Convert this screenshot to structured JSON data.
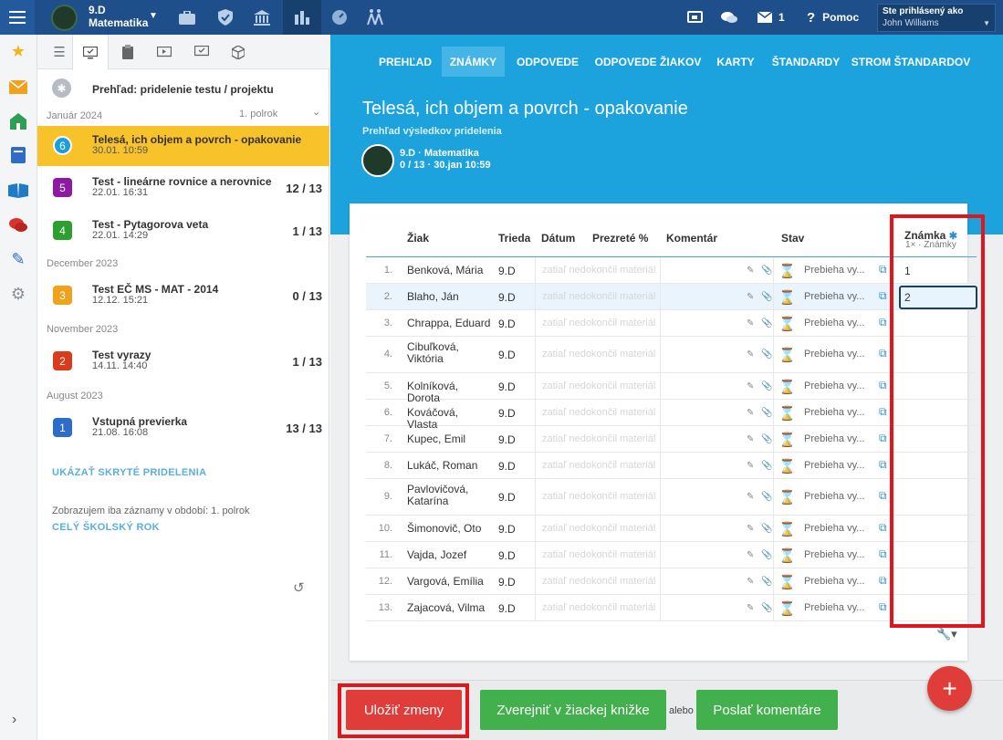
{
  "topbar": {
    "class_name": "9.D",
    "class_subject": "Matematika",
    "messages_count": "1",
    "help_label": "Pomoc",
    "login_label": "Ste prihlásený ako",
    "user_name": "John Williams"
  },
  "list": {
    "overview": "Prehľad: pridelenie testu / projektu",
    "semester": "1. polrok",
    "sections": {
      "jan": "Január 2024",
      "dec": "December 2023",
      "nov": "November 2023",
      "aug": "August 2023"
    },
    "items": [
      {
        "num": "6",
        "title": "Telesá, ich objem a povrch - opakovanie",
        "date": "30.01. 10:59",
        "count": "",
        "color": "#1a9fd9"
      },
      {
        "num": "5",
        "title": "Test - lineárne rovnice a nerovnice",
        "date": "22.01. 16:31",
        "count": "12 / 13",
        "color": "#8e1aa3"
      },
      {
        "num": "4",
        "title": "Test - Pytagorova veta",
        "date": "22.01. 14:29",
        "count": "1 / 13",
        "color": "#2e9e2e"
      },
      {
        "num": "3",
        "title": "Test EČ MS - MAT - 2014",
        "date": "12.12. 15:21",
        "count": "0 / 13",
        "color": "#f0a21c"
      },
      {
        "num": "2",
        "title": "Test vyrazy",
        "date": "14.11. 14:40",
        "count": "1 / 13",
        "color": "#d93c1b"
      },
      {
        "num": "1",
        "title": "Vstupná previerka",
        "date": "21.08. 16:08",
        "count": "13 / 13",
        "color": "#2e6cc9"
      }
    ],
    "show_hidden": "UKÁZAŤ SKRYTÉ PRIDELENIA",
    "note": "Zobrazujem iba záznamy v období: 1. polrok",
    "whole_year": "CELÝ ŠKOLSKÝ ROK"
  },
  "nav": {
    "tabs": [
      "PREHĽAD",
      "ZNÁMKY",
      "ODPOVEDE",
      "ODPOVEDE ŽIAKOV",
      "KARTY",
      "ŠTANDARDY",
      "STROM ŠTANDARDOV"
    ]
  },
  "hero": {
    "title": "Telesá, ich objem a povrch - opakovanie",
    "subtitle": "Prehľad výsledkov pridelenia",
    "class_line": "9.D · Matematika",
    "meta_line": "0 / 13 · 30.jan 10:59"
  },
  "table": {
    "headers": {
      "student": "Žiak",
      "class": "Trieda",
      "date": "Dátum",
      "viewed": "Prezreté %",
      "comment": "Komentár",
      "status": "Stav",
      "grade": "Známka",
      "grade_sub": "1× · Známky"
    },
    "placeholder_date": "zatiaľ nedokončil materiál",
    "status_text": "Prebieha vy...",
    "rows": [
      {
        "num": "1.",
        "name": "Benková, Mária",
        "class": "9.D",
        "grade": "1"
      },
      {
        "num": "2.",
        "name": "Blaho, Ján",
        "class": "9.D",
        "grade": "2"
      },
      {
        "num": "3.",
        "name": "Chrappa, Eduard",
        "class": "9.D",
        "grade": ""
      },
      {
        "num": "4.",
        "name": "Cibuľková, Viktória",
        "class": "9.D",
        "grade": ""
      },
      {
        "num": "5.",
        "name": "Kolníková, Dorota",
        "class": "9.D",
        "grade": ""
      },
      {
        "num": "6.",
        "name": "Kováčová, Vlasta",
        "class": "9.D",
        "grade": ""
      },
      {
        "num": "7.",
        "name": "Kupec, Emil",
        "class": "9.D",
        "grade": ""
      },
      {
        "num": "8.",
        "name": "Lukáč, Roman",
        "class": "9.D",
        "grade": ""
      },
      {
        "num": "9.",
        "name": "Pavlovičová, Katarína",
        "class": "9.D",
        "grade": ""
      },
      {
        "num": "10.",
        "name": "Šimonovič, Oto",
        "class": "9.D",
        "grade": ""
      },
      {
        "num": "11.",
        "name": "Vajda, Jozef",
        "class": "9.D",
        "grade": ""
      },
      {
        "num": "12.",
        "name": "Vargová, Emília",
        "class": "9.D",
        "grade": ""
      },
      {
        "num": "13.",
        "name": "Zajacová, Vilma",
        "class": "9.D",
        "grade": ""
      }
    ]
  },
  "actions": {
    "save": "Uložiť zmeny",
    "publish": "Zverejniť v žiackej knižke",
    "or": "alebo",
    "send": "Poslať komentáre",
    "fab": "+"
  },
  "colors": {
    "topbar": "#1e4f8a",
    "accent": "#1ca2dd",
    "selected": "#f7c22a",
    "red": "#e03d3a",
    "green": "#41b04d",
    "highlight_box": "#e4141b"
  }
}
